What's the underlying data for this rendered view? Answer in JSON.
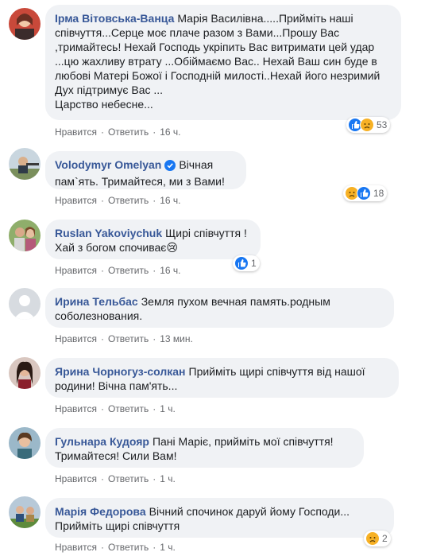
{
  "labels": {
    "like": "Нравится",
    "reply": "Ответить",
    "dot": "·"
  },
  "colors": {
    "author": "#385898",
    "bubble": "#f0f2f5",
    "meta": "#65676b",
    "like_blue": "#1877f2",
    "sad_yellow": "#f7b125",
    "verified": "#1877f2"
  },
  "comments": [
    {
      "author": "Ірма Вітовська-Ванца",
      "text": "Марія Василівна.....Прийміть наші співчуття...Серце моє плаче разом з Вами...Прошу Вас ,тримайтесь! Нехай Господь укріпить Вас витримати цей удар ...цю жахливу втрату ...Обіймаємо Вас.. Нехай Ваш син буде в любові Матері Божої і Господній милості..Нехай його незримий Дух підтримує Вас ...\nЦарство небесне...",
      "time": "16 ч.",
      "reactions": [
        "like-icon",
        "sad-icon"
      ],
      "reaction_count": "53"
    },
    {
      "author": "Volodymyr Omelyan",
      "verified": true,
      "text": "Вічная пам`ять. Тримайтеся, ми з Вами!",
      "time": "16 ч.",
      "reactions": [
        "sad-icon",
        "like-icon"
      ],
      "reaction_count": "18"
    },
    {
      "author": "Ruslan Yakoviychuk",
      "text": "Щирі співчуття !\nХай з богом спочиває😢",
      "time": "16 ч.",
      "reactions": [
        "like-icon"
      ],
      "reaction_count": "1"
    },
    {
      "author": "Ирина Тельбас",
      "text": "Земля пухом вечная память.родным соболезнования.",
      "time": "13 мин.",
      "reactions": [],
      "reaction_count": ""
    },
    {
      "author": "Ярина Чорногуз-солкан",
      "text": "Прийміть щирі співчуття від нашої родини! Вічна пам'ять...",
      "time": "1 ч.",
      "reactions": [],
      "reaction_count": ""
    },
    {
      "author": "Гульнара Кудояр",
      "text": "Пані Маріє, прийміть мої співчуття! Тримайтеся! Сили Вам!",
      "time": "1 ч.",
      "reactions": [],
      "reaction_count": ""
    },
    {
      "author": "Марія Федорова",
      "text": "Вічний спочинок даруй йому Господи... Прийміть щирі співчуття",
      "time": "1 ч.",
      "reactions": [
        "sad-icon"
      ],
      "reaction_count": "2"
    }
  ]
}
